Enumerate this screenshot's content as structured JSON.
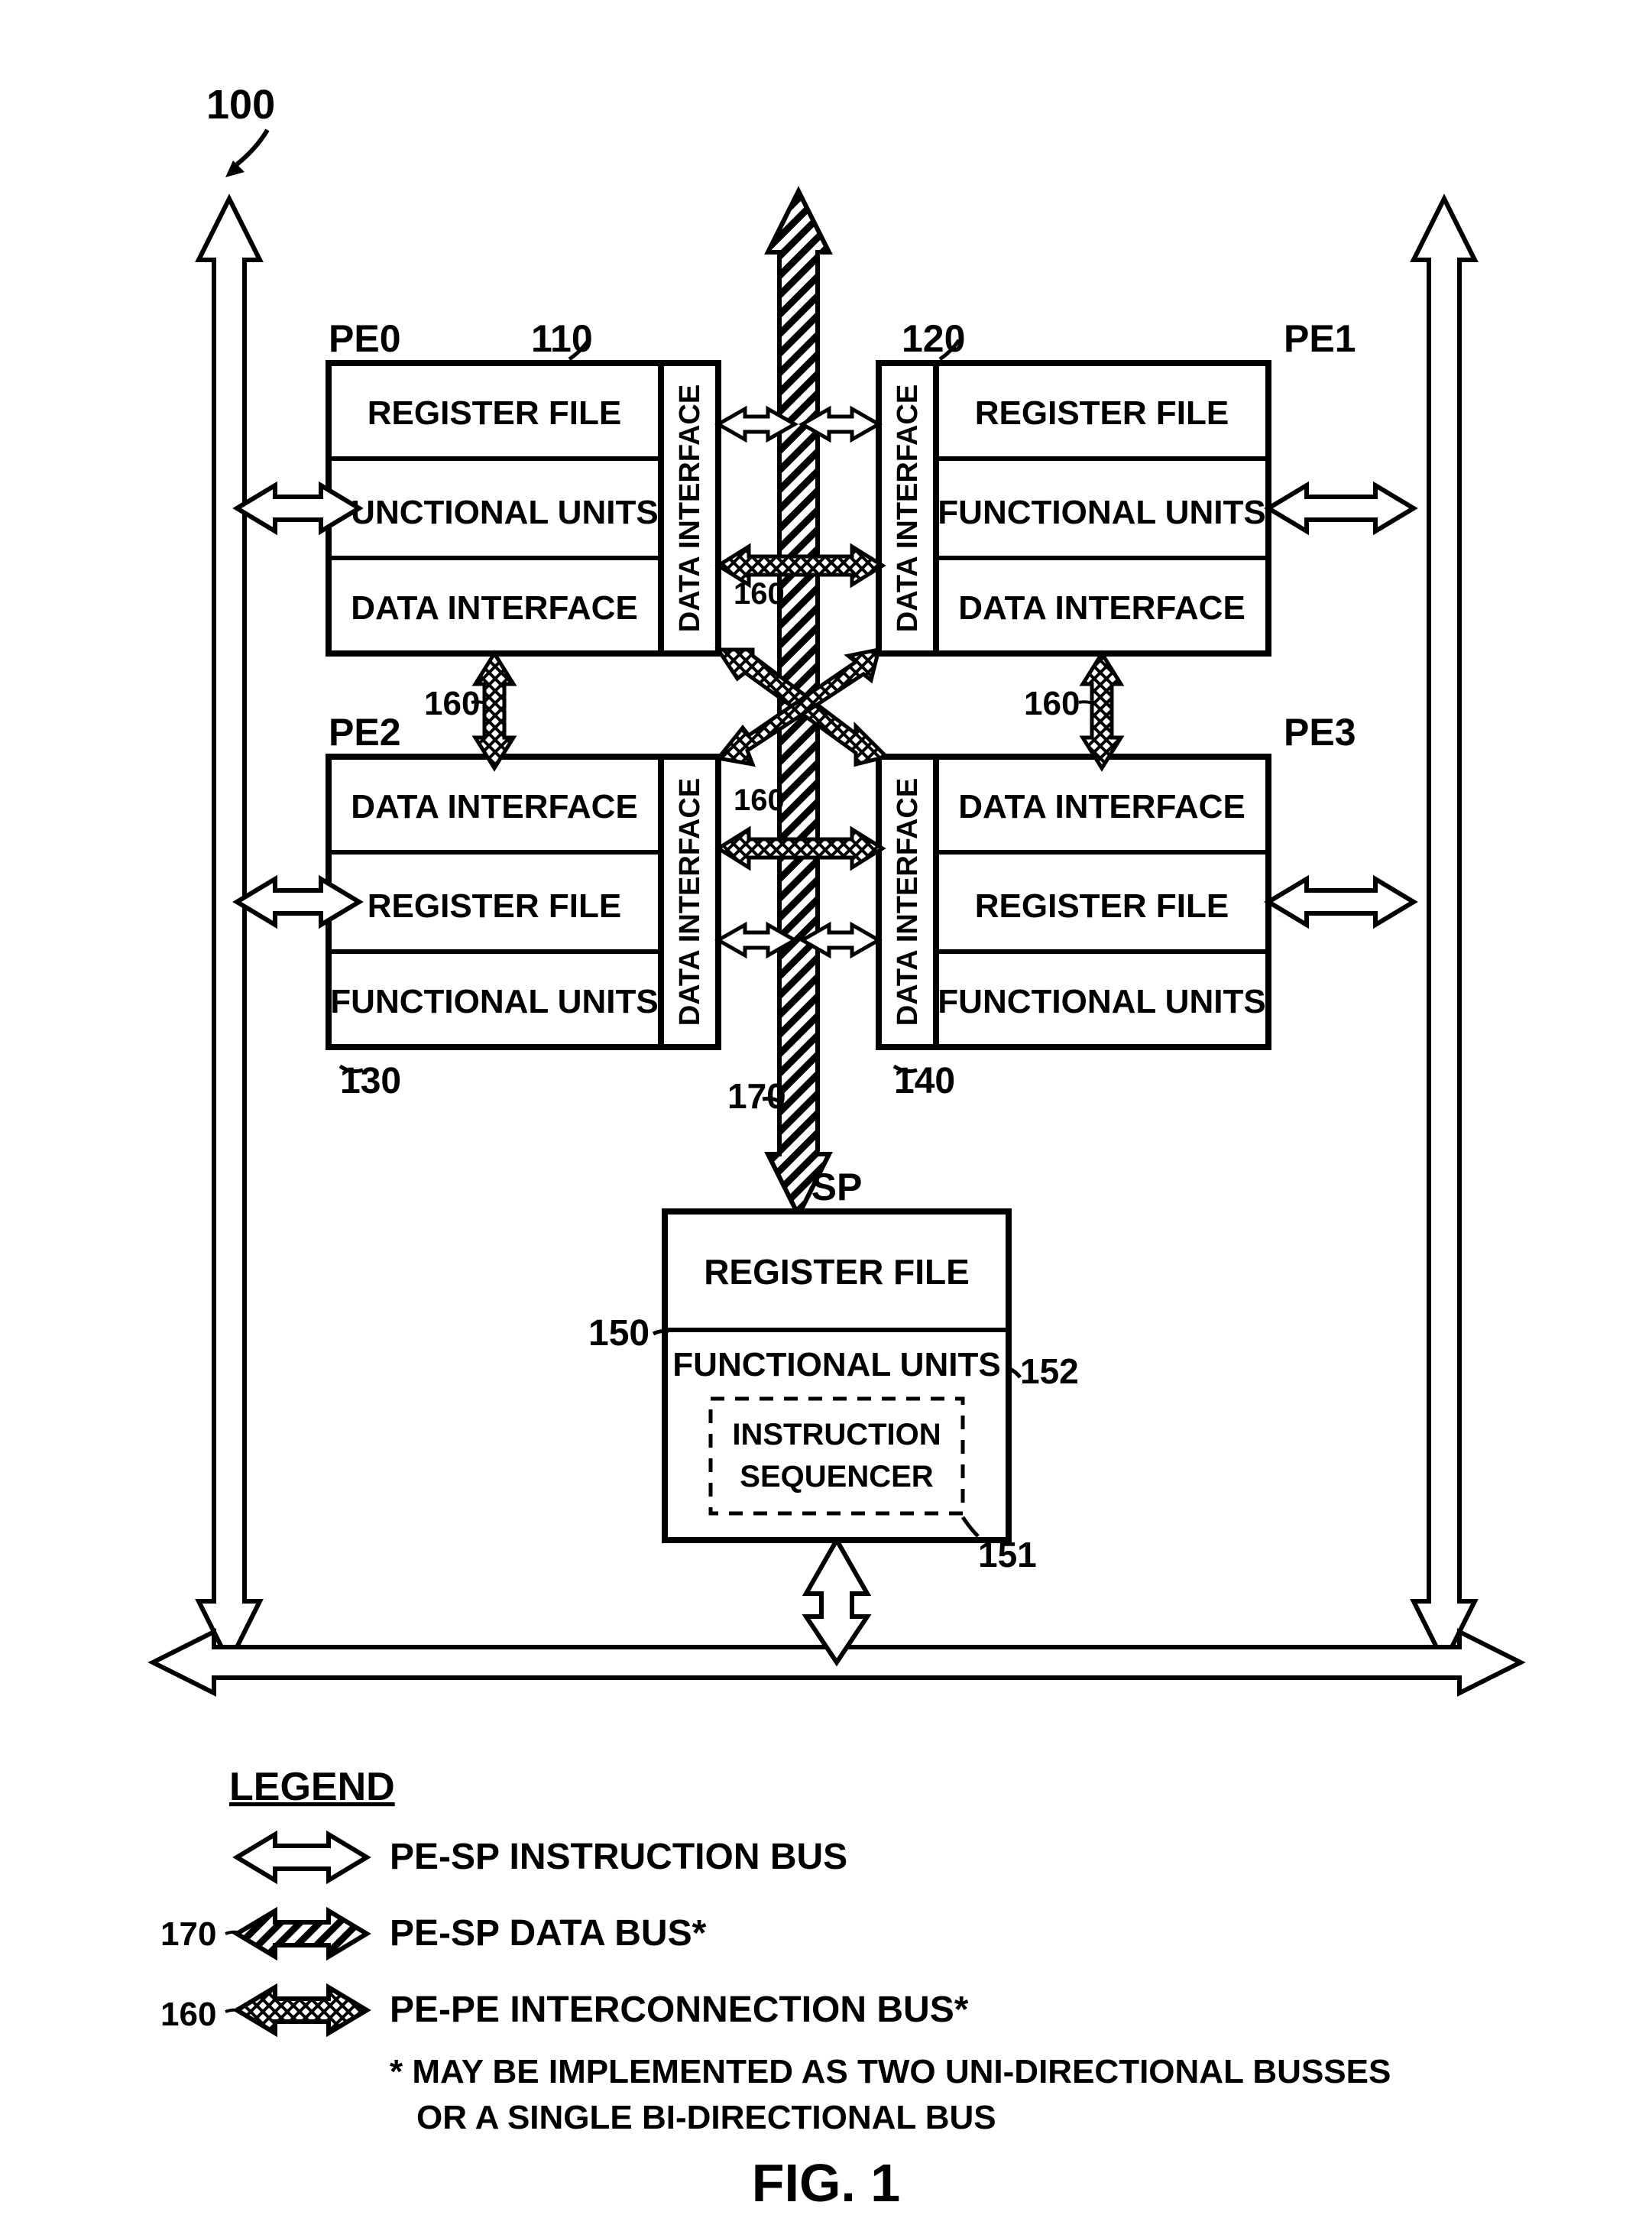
{
  "figure": {
    "reference": "100",
    "title": "FIG. 1"
  },
  "pe0": {
    "name": "PE0",
    "ref": "110",
    "row1": "REGISTER FILE",
    "row2": "FUNCTIONAL UNITS",
    "row3": "DATA INTERFACE",
    "side": "DATA INTERFACE"
  },
  "pe1": {
    "name": "PE1",
    "ref": "120",
    "row1": "REGISTER FILE",
    "row2": "FUNCTIONAL UNITS",
    "row3": "DATA INTERFACE",
    "side": "DATA INTERFACE"
  },
  "pe2": {
    "name": "PE2",
    "ref": "130",
    "row1": "DATA INTERFACE",
    "row2": "REGISTER FILE",
    "row3": "FUNCTIONAL UNITS",
    "side": "DATA INTERFACE"
  },
  "pe3": {
    "name": "PE3",
    "ref": "140",
    "row1": "DATA INTERFACE",
    "row2": "REGISTER FILE",
    "row3": "FUNCTIONAL UNITS",
    "side": "DATA INTERFACE"
  },
  "sp": {
    "name": "SP",
    "ref": "150",
    "row1": "REGISTER FILE",
    "row2": "FUNCTIONAL UNITS",
    "seq": "INSTRUCTION\nSEQUENCER",
    "ref_seq": "151",
    "ref_fu": "152"
  },
  "refs": {
    "interconn": "160",
    "databus": "170"
  },
  "legend": {
    "title": "LEGEND",
    "item1": "PE-SP INSTRUCTION BUS",
    "item2": "PE-SP DATA BUS*",
    "item3": "PE-PE INTERCONNECTION BUS*",
    "note": "* MAY BE IMPLEMENTED AS TWO UNI-DIRECTIONAL BUSSES\n   OR A SINGLE BI-DIRECTIONAL BUS",
    "ref_databus": "170",
    "ref_interconn": "160"
  }
}
